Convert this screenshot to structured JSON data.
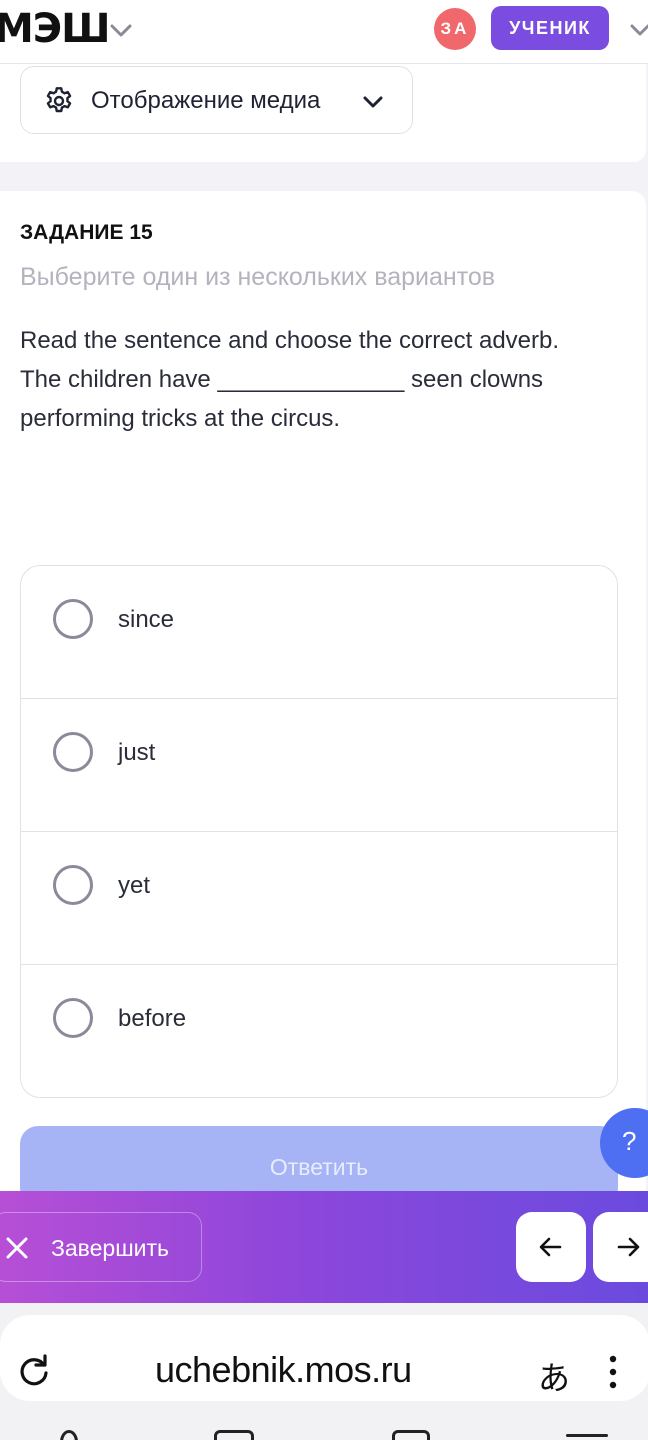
{
  "header": {
    "logo": "МЭШ",
    "avatar_initials": "ЗА",
    "role_badge": "УЧЕНИК",
    "colors": {
      "avatar": "#f0686b",
      "badge": "#7b4ce0"
    }
  },
  "media": {
    "label": "Отображение медиа",
    "icon": "gear-icon"
  },
  "task": {
    "title": "ЗАДАНИЕ 15",
    "hint": "Выберите один из нескольких вариантов",
    "question_lines": [
      "Read the sentence and choose the correct adverb.",
      "The children have ______________ seen clowns",
      "performing tricks at the circus."
    ],
    "options": [
      {
        "label": "since",
        "selected": false
      },
      {
        "label": "just",
        "selected": false
      },
      {
        "label": "yet",
        "selected": false
      },
      {
        "label": "before",
        "selected": false
      }
    ],
    "submit_label": "Ответить"
  },
  "help_label": "?",
  "actions": {
    "finish_label": "Завершить",
    "prev_icon": "arrow-left-icon",
    "next_icon": "arrow-right-icon"
  },
  "browser": {
    "url": "uchebnik.mos.ru",
    "translate_glyph": "あ"
  },
  "colors": {
    "accent": "#6a4bde",
    "submit_disabled": "#a6b4f6",
    "help_fab": "#4f6ff2"
  }
}
